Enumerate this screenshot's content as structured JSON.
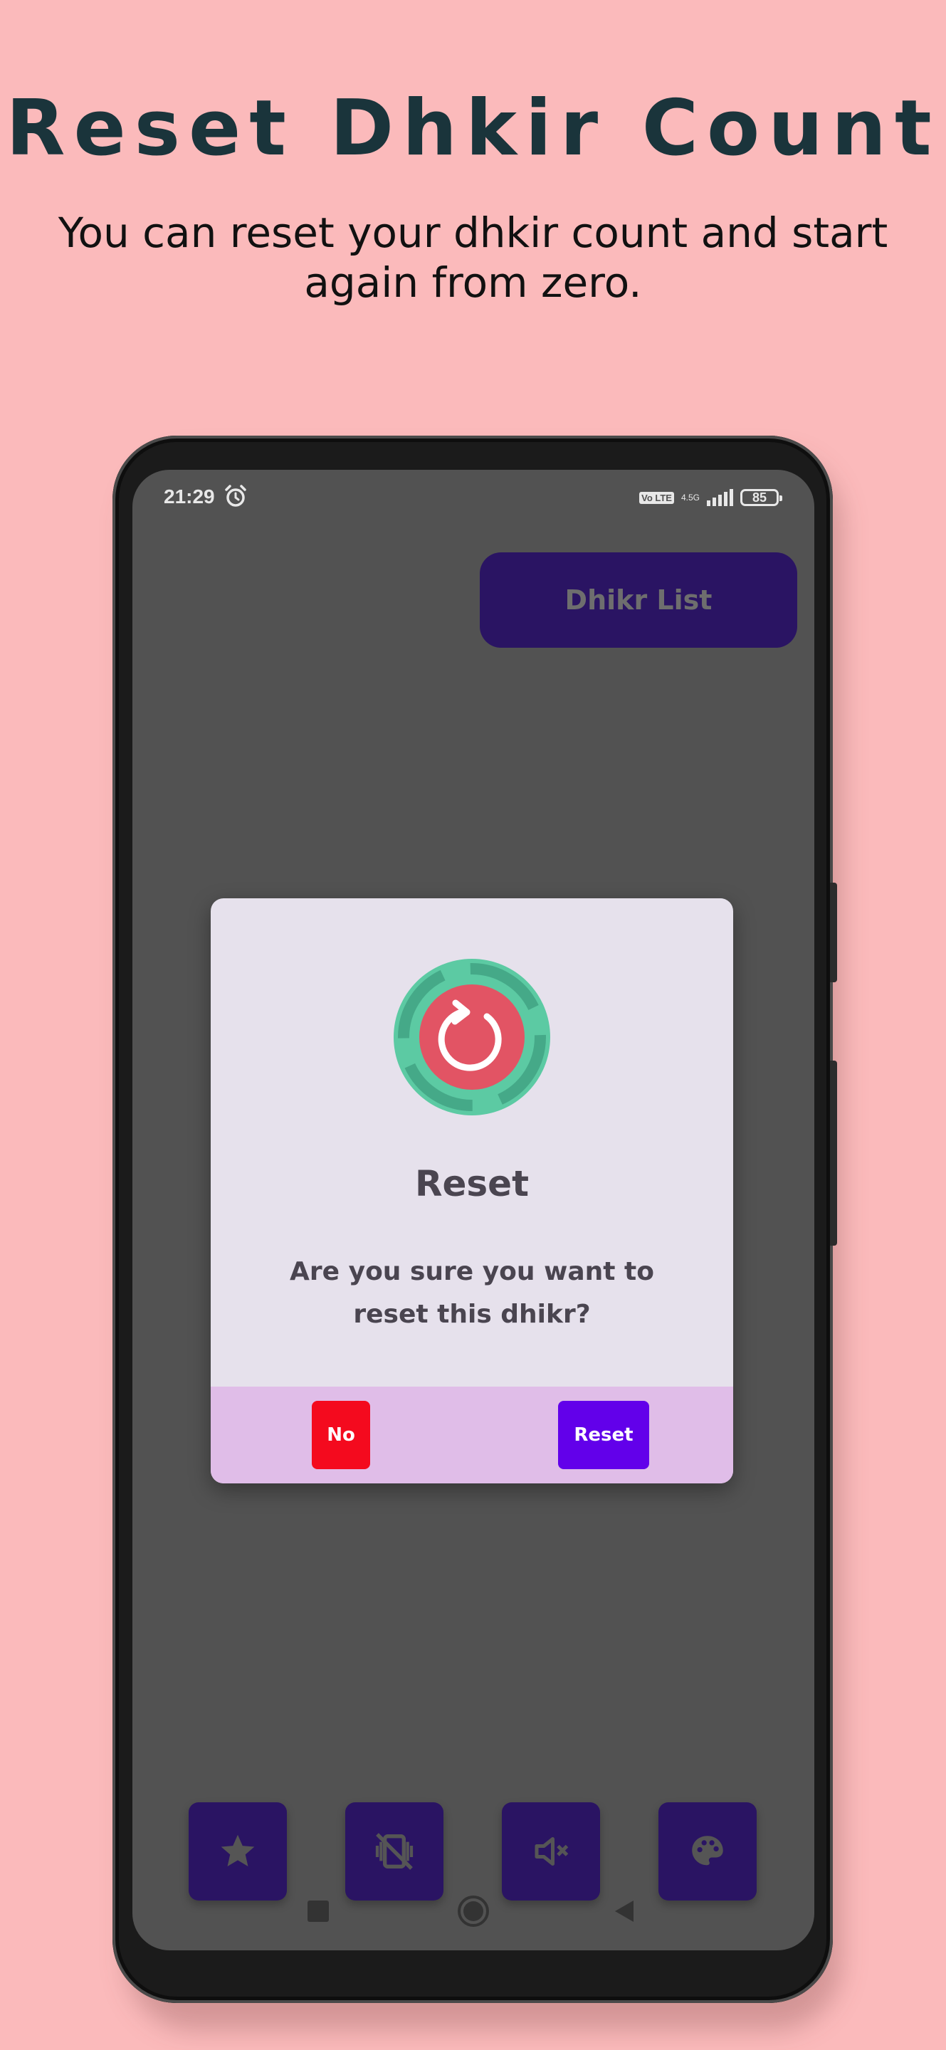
{
  "promo": {
    "title": "Reset Dhkir Count",
    "subtitle": "You can reset your dhkir count and start again from zero."
  },
  "status_bar": {
    "time": "21:29",
    "network_type": "4.5G",
    "volte_label": "Vo LTE",
    "battery_level": "85",
    "icons": [
      "alarm-icon",
      "volte-icon",
      "signal-icon",
      "battery-icon"
    ]
  },
  "app": {
    "dhikr_list_button": "Dhikr List",
    "toolbar_icons": [
      "star-icon",
      "vibrate-off-icon",
      "volume-mute-icon",
      "palette-icon"
    ]
  },
  "dialog": {
    "icon": "reset-icon",
    "title": "Reset",
    "message": "Are you sure you want to reset this dhikr?",
    "no_label": "No",
    "reset_label": "Reset"
  },
  "navigation_bar": {
    "icons": [
      "recents-icon",
      "home-icon",
      "back-icon"
    ]
  },
  "colors": {
    "background": "#fbbabb",
    "headline": "#1a343b",
    "app_button": "#2a1463",
    "dialog_bg": "#e6e1ec",
    "dialog_footer": "#e0bde8",
    "no_button": "#f40a1e",
    "reset_button": "#6200ea",
    "emblem_ring": "#5ccaa3",
    "emblem_center": "#e25464"
  }
}
